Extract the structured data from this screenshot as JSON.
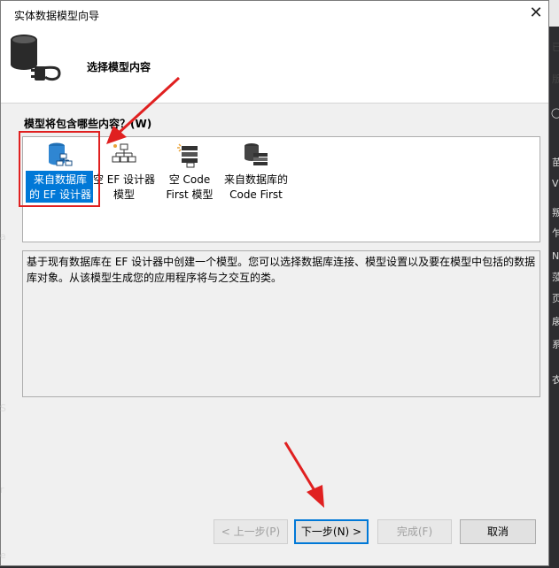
{
  "window": {
    "title": "实体数据模型向导",
    "close_label": "✕"
  },
  "header": {
    "title": "选择模型内容",
    "icon": "database-plug-icon"
  },
  "section": {
    "label": "模型将包含哪些内容？(W)"
  },
  "model_options": [
    {
      "label": "来自数据库\n的 EF 设计器",
      "icon": "database-designer-icon",
      "selected": true
    },
    {
      "label": "空 EF 设计器\n模型",
      "icon": "hierarchy-model-icon",
      "selected": false
    },
    {
      "label": "空 Code\nFirst 模型",
      "icon": "code-first-icon",
      "selected": false
    },
    {
      "label": "来自数据库的\nCode First",
      "icon": "database-code-first-icon",
      "selected": false
    }
  ],
  "description": "基于现有数据库在 EF 设计器中创建一个模型。您可以选择数据库连接、模型设置以及要在模型中包括的数据库对象。从该模型生成您的应用程序将与之交互的类。",
  "buttons": {
    "prev": "< 上一步(P)",
    "next": "下一步(N) >",
    "finish": "完成(F)",
    "cancel": "取消"
  },
  "colors": {
    "selection": "#0078d7",
    "annotation": "#e02020"
  }
}
